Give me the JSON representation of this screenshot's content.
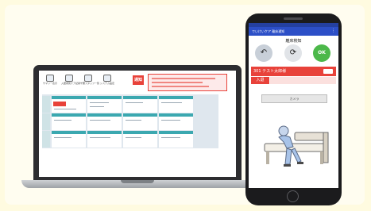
{
  "colors": {
    "background": "#fffbe0",
    "accent_red": "#e8423a",
    "app_blue": "#2c4fc7",
    "teal": "#3ba8b0",
    "ok_green": "#4cb84a"
  },
  "laptop": {
    "toolbar": [
      {
        "icon": "grid-icon",
        "label": "サマリー表示"
      },
      {
        "icon": "list-icon",
        "label": "入居者別ケア記録一覧"
      },
      {
        "icon": "group-icon",
        "label": "ケアスタッフ一覧"
      },
      {
        "icon": "settings-icon",
        "label": "システム設定"
      }
    ],
    "alert_button": "通知"
  },
  "phone": {
    "app_title": "でいけいケア 離床通知",
    "section_label": "離床検知",
    "ok_label": "OK",
    "resident": "301 テスト太郎様",
    "status": "入退",
    "confirm_label": "カメラ"
  }
}
